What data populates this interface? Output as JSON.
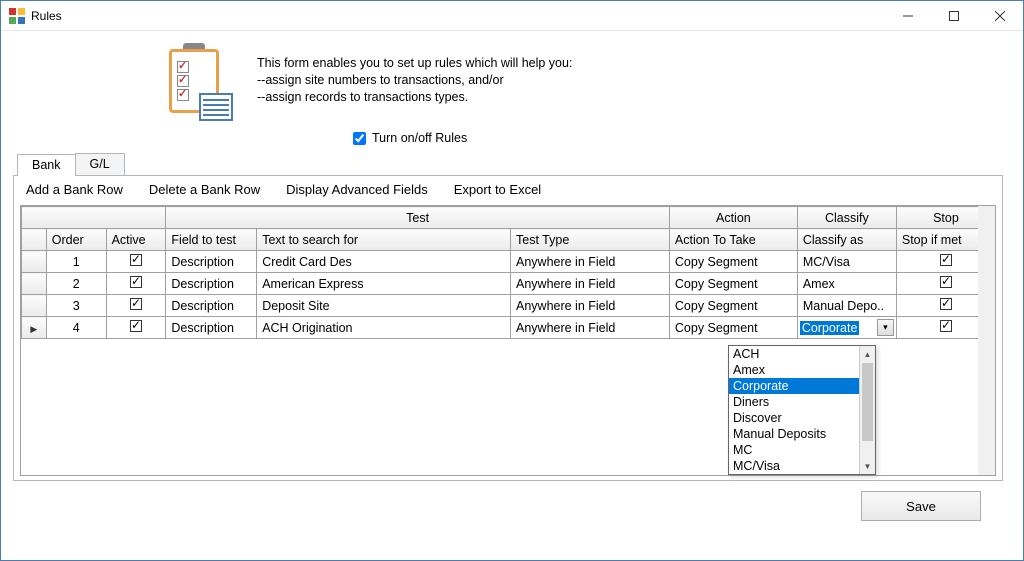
{
  "window": {
    "title": "Rules"
  },
  "intro": {
    "line1": "This form enables you to set up rules which will help you:",
    "line2": "--assign site numbers to transactions, and/or",
    "line3": "--assign records to transactions types."
  },
  "toggle": {
    "label": "Turn on/off Rules",
    "checked": true
  },
  "tabs": [
    {
      "id": "bank",
      "label": "Bank",
      "active": true
    },
    {
      "id": "gl",
      "label": "G/L",
      "active": false
    }
  ],
  "toolbar": {
    "add": "Add a Bank Row",
    "delete": "Delete a Bank Row",
    "adv": "Display Advanced Fields",
    "export": "Export to Excel"
  },
  "grid": {
    "groups": {
      "test": "Test",
      "action": "Action",
      "classify": "Classify",
      "stop": "Stop"
    },
    "columns": {
      "order": "Order",
      "active": "Active",
      "field": "Field to test",
      "text": "Text to search for",
      "type": "Test Type",
      "action": "Action To Take",
      "classify": "Classify as",
      "stop": "Stop if met"
    },
    "rows": [
      {
        "order": "1",
        "active": true,
        "field": "Description",
        "text": "Credit Card Des",
        "type": "Anywhere in Field",
        "action": "Copy Segment",
        "classify": "MC/Visa",
        "stop": true,
        "selected": false,
        "editing": false
      },
      {
        "order": "2",
        "active": true,
        "field": "Description",
        "text": "American Express",
        "type": "Anywhere in Field",
        "action": "Copy Segment",
        "classify": "Amex",
        "stop": true,
        "selected": false,
        "editing": false
      },
      {
        "order": "3",
        "active": true,
        "field": "Description",
        "text": "Deposit Site",
        "type": "Anywhere in Field",
        "action": "Copy Segment",
        "classify": "Manual  Depo..",
        "stop": true,
        "selected": false,
        "editing": false
      },
      {
        "order": "4",
        "active": true,
        "field": "Description",
        "text": "ACH Origination",
        "type": "Anywhere in Field",
        "action": "Copy Segment",
        "classify": "Corporate",
        "stop": true,
        "selected": true,
        "editing": true
      }
    ]
  },
  "dropdown": {
    "open": true,
    "selected": "Corporate",
    "items": [
      "ACH",
      "Amex",
      "Corporate",
      "Diners",
      "Discover",
      "Manual Deposits",
      "MC",
      "MC/Visa"
    ]
  },
  "buttons": {
    "save": "Save"
  }
}
